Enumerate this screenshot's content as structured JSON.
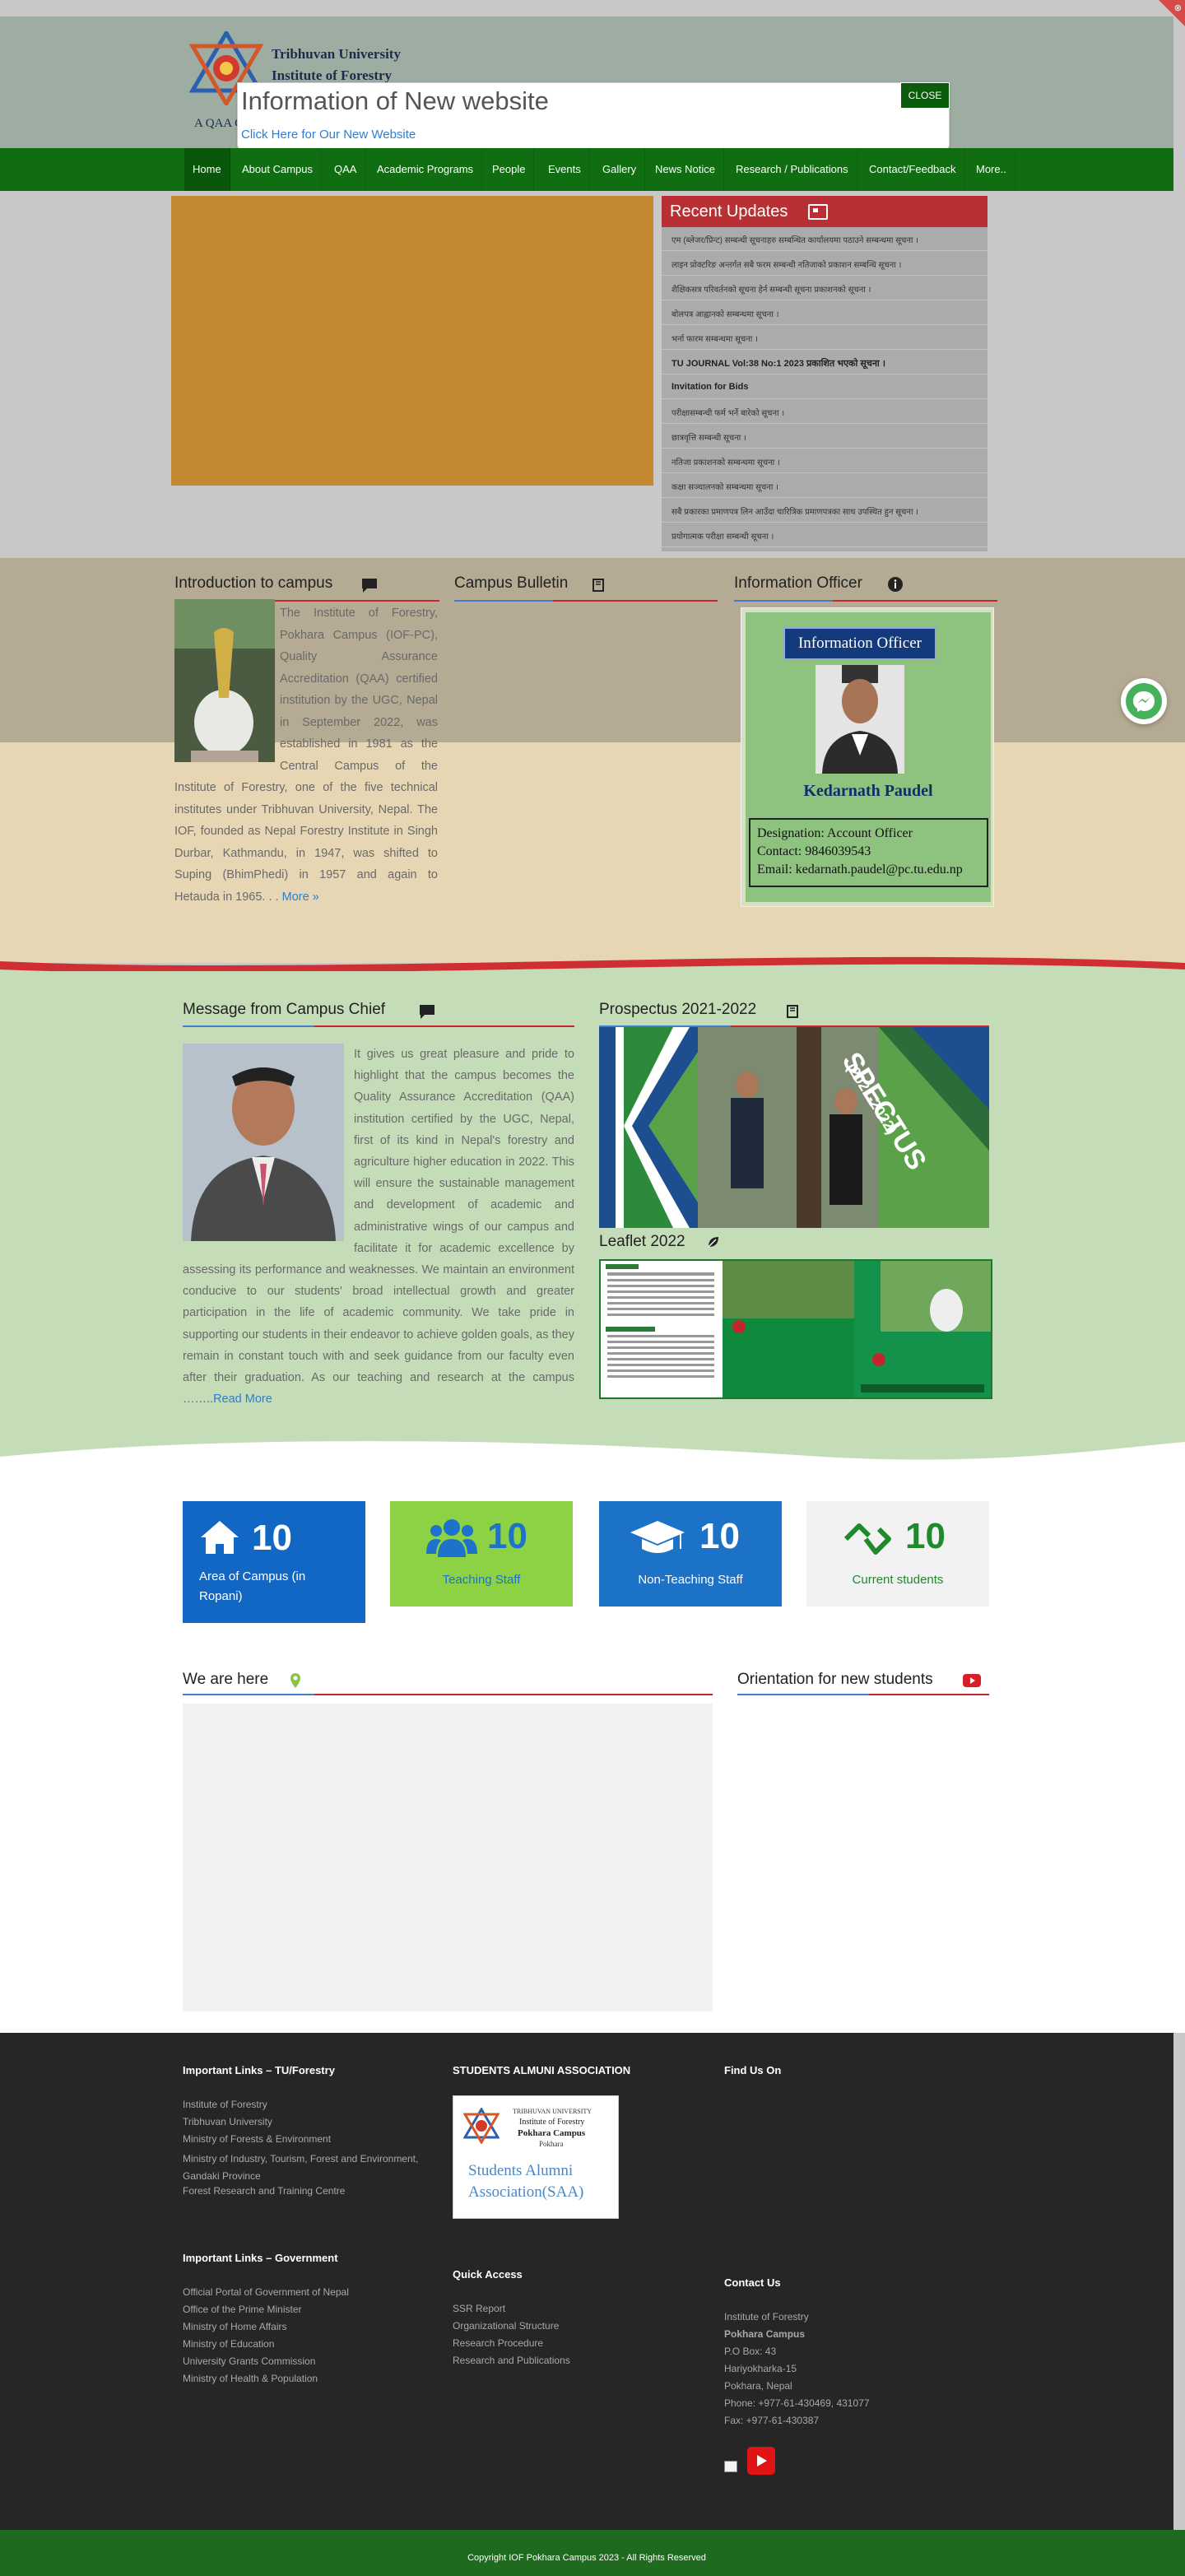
{
  "header": {
    "university_name": "Tribhuvan University",
    "institute_name": "Institute of Forestry",
    "qaa_fragment": "A QAA C",
    "corner_icon": "⊗"
  },
  "popup": {
    "title": "Information of New website",
    "link_text": "Click Here for Our New Website",
    "close_label": "CLOSE"
  },
  "nav": {
    "items": [
      "Home",
      "About Campus",
      "QAA",
      "Academic Programs",
      "People",
      "Events",
      "Gallery",
      "News Notice",
      "Research / Publications",
      "Contact/Feedback",
      "More.."
    ]
  },
  "updates": {
    "title": "Recent Updates",
    "items": [
      "एम (ब्लेजर/प्रिन्ट) सम्बन्धी सूचनाहरु सम्बन्धित कार्यालयमा पठाउने सम्बन्धमा सूचना ।",
      "लाइन प्रोक्टरिङ अन्तर्गत सबै फरम सम्बन्धी नतिजाको प्रकाशन सम्बन्धि सूचना ।",
      "शैक्षिकसत्र परिवर्तनको सूचना हेर्न सम्बन्धी सूचना प्रकाशनको सूचना ।",
      "बोलपत्र आह्वानको सम्बन्धमा सूचना ।",
      "भर्ना फारम सम्बन्धमा सूचना ।",
      "TU JOURNAL Vol:38 No:1 2023 प्रकाशित भएको सूचना ।",
      "Invitation for Bids",
      "परीक्षासम्बन्धी फर्म भर्ने बारेको सूचना ।",
      "छात्रवृत्ति सम्बन्धी सूचना ।",
      "नतिजा प्रकाशनको सम्बन्धमा सूचना ।",
      "कक्षा सञ्चालनको सम्बन्धमा सूचना ।",
      "सबै प्रकारका प्रमाणपत्र लिन आउँदा चारित्रिक प्रमाणपत्रका साथ उपस्थित हुन सूचना ।",
      "प्रयोगात्मक परीक्षा सम्बन्धी सूचना ।"
    ]
  },
  "intro": {
    "title": "Introduction to campus",
    "text": "The Institute of Forestry, Pokhara Campus (IOF-PC), Quality Assurance Accreditation (QAA) certified institution by the UGC, Nepal in September 2022, was established in 1981 as the Central Campus of the Institute of Forestry, one of the five technical institutes under Tribhuvan University, Nepal. The IOF, founded as Nepal Forestry Institute in Singh Durbar, Kathmandu, in 1947, was shifted to Suping (BhimPhedi) in 1957 and again to Hetauda in 1965. . .",
    "more": "More »"
  },
  "bulletin": {
    "title": "Campus Bulletin"
  },
  "info_officer": {
    "title": "Information Officer",
    "badge": "Information Officer",
    "name": "Kedarnath Paudel",
    "designation": "Designation: Account Officer",
    "contact": "Contact: 9846039543",
    "email": "Email: kedarnath.paudel@pc.tu.edu.np"
  },
  "chief": {
    "title": "Message from Campus Chief",
    "text": "It gives us great pleasure and pride to highlight that the campus becomes the Quality Assurance Accreditation (QAA) institution certified by the UGC, Nepal, first of its kind in Nepal's forestry and agriculture higher education in 2022. This will ensure the sustainable management and development of academic and administrative wings of our campus and facilitate it for academic excellence by assessing its performance and weaknesses. We maintain an environment conducive to our students' broad intellectual growth and greater participation in the life of academic community. We take pride in supporting our students in their endeavor to achieve golden goals, as they remain in constant touch with and seek guidance from our faculty even after their graduation. As our teaching and research at the campus ……..",
    "more": "Read More"
  },
  "prospectus": {
    "title": "Prospectus 2021-2022",
    "banner": "SPECTUS",
    "years": "(2021-2022)"
  },
  "leaflet": {
    "title": "Leaflet 2022"
  },
  "stats": [
    {
      "number": "10",
      "label": "Area of Campus (in Ropani)",
      "icon": "home-icon",
      "bg": "#1267c4"
    },
    {
      "number": "10",
      "label": "Teaching Staff",
      "icon": "users-icon",
      "bg": "#8dd144"
    },
    {
      "number": "10",
      "label": "Non-Teaching Staff",
      "icon": "graduation-cap-icon",
      "bg": "#1b72c7"
    },
    {
      "number": "10",
      "label": "Current students",
      "icon": "link-icon",
      "bg": "#f2f2f2"
    }
  ],
  "we_are_here": {
    "title": "We are here"
  },
  "orientation": {
    "title": "Orientation for new students"
  },
  "footer": {
    "col1_title": "Important Links – TU/Forestry",
    "col1_links": [
      "Institute of Forestry",
      "Tribhuvan University",
      "Ministry of Forests & Environment",
      "Ministry of Industry, Tourism, Forest and Environment, Gandaki Province",
      "Forest Research and Training Centre"
    ],
    "col2_title": "Important Links – Government",
    "col2_links": [
      "Official Portal of Government of Nepal",
      "Office of the Prime Minister",
      "Ministry of Home Affairs",
      "Ministry of Education",
      "University Grants Commission",
      "Ministry of Health & Population"
    ],
    "alumni_title": "STUDENTS ALMUNI ASSOCIATION",
    "alumni_logo": {
      "line1": "TRIBHUVAN UNIVERSITY",
      "line2": "Institute of Forestry",
      "line3": "Pokhara Campus",
      "line4": "Pokhara",
      "line5": "Students Alumni",
      "line6": "Association(SAA)"
    },
    "quick_title": "Quick Access",
    "quick_links": [
      "SSR Report",
      "Organizational Structure",
      "Research Procedure",
      "Research and Publications"
    ],
    "find_us": "Find Us On",
    "contact_title": "Contact Us",
    "contact_lines": [
      "Institute of Forestry",
      "Pokhara Campus",
      "P.O Box: 43",
      "Hariyokharka-15",
      "Pokhara, Nepal",
      "Phone: +977-61-430469, 431077",
      "Fax: +977-61-430387"
    ],
    "copyright": "Copyright IOF Pokhara Campus 2023 - All Rights Reserved"
  }
}
